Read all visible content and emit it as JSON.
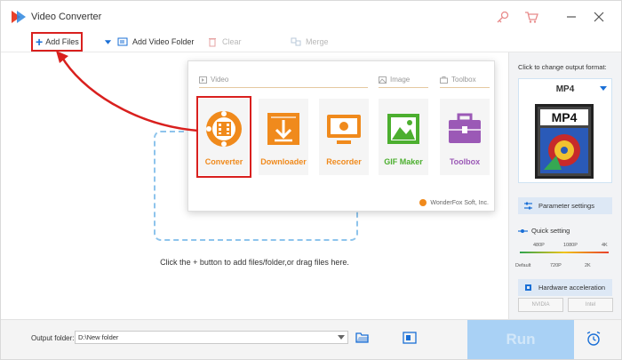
{
  "window": {
    "title": "Video Converter",
    "icons": [
      "app-logo-icon",
      "key-icon",
      "cart-icon",
      "minimize-icon",
      "close-icon"
    ]
  },
  "toolbar": {
    "add_files": "Add Files",
    "add_video_folder": "Add Video Folder",
    "clear": "Clear",
    "merge": "Merge"
  },
  "main": {
    "hint": "Click the + button to add files/folder,or drag files here."
  },
  "popup": {
    "sections": {
      "video": "Video",
      "image": "Image",
      "toolbox": "Toolbox"
    },
    "tiles": [
      {
        "label": "Converter",
        "icon": "film-reel-icon",
        "color": "#f08a1c",
        "selected": true
      },
      {
        "label": "Downloader",
        "icon": "download-icon",
        "color": "#f08a1c",
        "selected": false
      },
      {
        "label": "Recorder",
        "icon": "screen-record-icon",
        "color": "#f08a1c",
        "selected": false
      },
      {
        "label": "GIF Maker",
        "icon": "image-icon",
        "color": "#4caf2f",
        "selected": false
      },
      {
        "label": "Toolbox",
        "icon": "toolbox-icon",
        "color": "#9b59b6",
        "selected": false
      }
    ],
    "brand": "WonderFox Soft, Inc."
  },
  "right_panel": {
    "hint": "Click to change output format:",
    "format": "MP4",
    "format_art_label": "MP4",
    "parameter_settings": "Parameter settings",
    "quick_setting": "Quick setting",
    "quality_ticks_top": [
      "480P",
      "1080P",
      "4K"
    ],
    "quality_ticks_bottom": [
      "Default",
      "720P",
      "2K"
    ],
    "hardware_acceleration": "Hardware acceleration",
    "hw_badges": [
      "NVIDIA",
      "Intel"
    ]
  },
  "bottom": {
    "output_label": "Output folder:",
    "output_value": "D:\\New folder",
    "run": "Run"
  },
  "colors": {
    "accent_blue": "#1a6fd6",
    "orange": "#f08a1c",
    "highlight_red": "#d9201e",
    "run_disabled": "#a9d1f5"
  }
}
